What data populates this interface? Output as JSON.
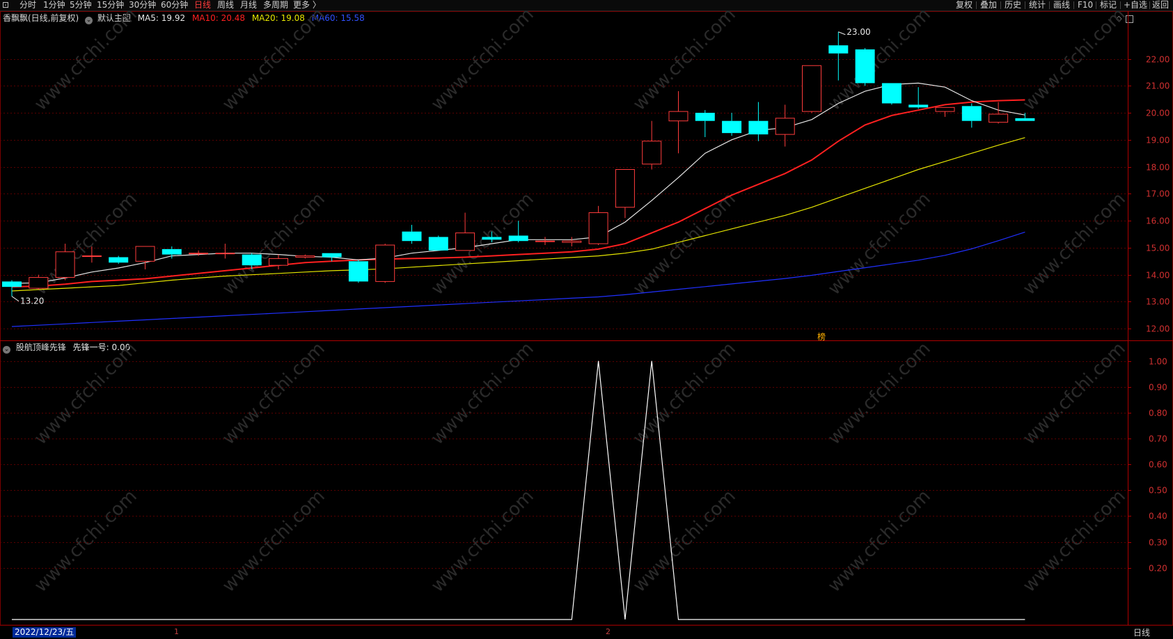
{
  "toolbar": {
    "left_icon": "⊡",
    "periods": [
      "分时",
      "1分钟",
      "5分钟",
      "15分钟",
      "30分钟",
      "60分钟",
      "日线",
      "周线",
      "月线",
      "多周期",
      "更多 〉"
    ],
    "active_period": "日线",
    "right_items": [
      "复权",
      "叠加",
      "历史",
      "统计",
      "画线",
      "F10",
      "标记",
      "+自选",
      "返回"
    ]
  },
  "main_header": {
    "stock_name": "香飘飘(日线,前复权)",
    "template": "默认主图",
    "ma5": "MA5: 19.92",
    "ma10": "MA10: 20.48",
    "ma20": "MA20: 19.08",
    "ma60": "MA60: 15.58"
  },
  "sub_header": {
    "indicator": "股航顶峰先锋",
    "line": "先锋一号: 0.00"
  },
  "price_annotations": {
    "high": "23.00",
    "low": "13.20",
    "marker": "榜"
  },
  "watermark": "www.cfchi.com",
  "colors": {
    "up": "#ff3c3c",
    "down": "#00ffff",
    "ma5": "#e6e6e6",
    "ma10": "#ff2020",
    "ma20": "#e6e600",
    "ma60": "#2030ff",
    "grid": "#5a0000"
  },
  "bottom": {
    "date": "2022/12/23/五",
    "month_1": "1",
    "month_2": "2",
    "period_label": "日线"
  },
  "chart_data": [
    {
      "type": "candlestick",
      "title": "香飘飘(日线,前复权)",
      "ylim": [
        11.8,
        23.2
      ],
      "y_ticks": [
        12.0,
        13.0,
        14.0,
        15.0,
        16.0,
        17.0,
        18.0,
        19.0,
        20.0,
        21.0,
        22.0
      ],
      "y_tick_labels": [
        "12.00",
        "13.00",
        "14.00",
        "15.00",
        "16.00",
        "17.00",
        "18.00",
        "19.00",
        "20.00",
        "21.00",
        "22.00"
      ],
      "candles": [
        {
          "o": 13.75,
          "h": 13.8,
          "c": 13.55,
          "l": 13.2
        },
        {
          "o": 13.5,
          "h": 14.0,
          "c": 13.9,
          "l": 13.45
        },
        {
          "o": 13.9,
          "h": 15.15,
          "c": 14.85,
          "l": 13.8
        },
        {
          "o": 14.7,
          "h": 15.05,
          "c": 14.7,
          "l": 14.45
        },
        {
          "o": 14.65,
          "h": 14.7,
          "c": 14.45,
          "l": 14.4
        },
        {
          "o": 14.5,
          "h": 15.05,
          "c": 15.05,
          "l": 14.2
        },
        {
          "o": 14.95,
          "h": 15.05,
          "c": 14.75,
          "l": 14.6
        },
        {
          "o": 14.8,
          "h": 14.9,
          "c": 14.8,
          "l": 14.7
        },
        {
          "o": 14.8,
          "h": 15.15,
          "c": 14.8,
          "l": 14.6
        },
        {
          "o": 14.75,
          "h": 14.8,
          "c": 14.35,
          "l": 14.2
        },
        {
          "o": 14.35,
          "h": 14.75,
          "c": 14.6,
          "l": 14.2
        },
        {
          "o": 14.65,
          "h": 14.75,
          "c": 14.7,
          "l": 14.6
        },
        {
          "o": 14.8,
          "h": 14.8,
          "c": 14.65,
          "l": 14.5
        },
        {
          "o": 14.5,
          "h": 14.55,
          "c": 13.75,
          "l": 13.7
        },
        {
          "o": 13.75,
          "h": 15.15,
          "c": 15.1,
          "l": 13.7
        },
        {
          "o": 15.6,
          "h": 15.85,
          "c": 15.25,
          "l": 15.15
        },
        {
          "o": 15.4,
          "h": 15.45,
          "c": 14.9,
          "l": 14.9
        },
        {
          "o": 14.9,
          "h": 16.3,
          "c": 15.55,
          "l": 14.9
        },
        {
          "o": 15.4,
          "h": 15.6,
          "c": 15.3,
          "l": 15.2
        },
        {
          "o": 15.45,
          "h": 16.0,
          "c": 15.25,
          "l": 15.2
        },
        {
          "o": 15.25,
          "h": 15.4,
          "c": 15.25,
          "l": 15.1
        },
        {
          "o": 15.2,
          "h": 15.4,
          "c": 15.25,
          "l": 15.05
        },
        {
          "o": 15.15,
          "h": 16.55,
          "c": 16.3,
          "l": 15.1
        },
        {
          "o": 16.5,
          "h": 17.9,
          "c": 17.9,
          "l": 16.1
        },
        {
          "o": 18.1,
          "h": 19.7,
          "c": 18.95,
          "l": 17.9
        },
        {
          "o": 19.7,
          "h": 20.8,
          "c": 20.05,
          "l": 18.5
        },
        {
          "o": 20.0,
          "h": 20.1,
          "c": 19.7,
          "l": 19.1
        },
        {
          "o": 19.7,
          "h": 20.0,
          "c": 19.25,
          "l": 19.15
        },
        {
          "o": 19.7,
          "h": 20.4,
          "c": 19.2,
          "l": 18.95
        },
        {
          "o": 19.2,
          "h": 20.3,
          "c": 19.8,
          "l": 18.75
        },
        {
          "o": 20.05,
          "h": 21.75,
          "c": 21.75,
          "l": 20.0
        },
        {
          "o": 22.5,
          "h": 23.0,
          "c": 22.2,
          "l": 21.2
        },
        {
          "o": 22.35,
          "h": 22.4,
          "c": 21.1,
          "l": 21.0
        },
        {
          "o": 21.1,
          "h": 21.1,
          "c": 20.35,
          "l": 20.3
        },
        {
          "o": 20.3,
          "h": 20.95,
          "c": 20.2,
          "l": 20.15
        },
        {
          "o": 20.05,
          "h": 20.2,
          "c": 20.2,
          "l": 19.85
        },
        {
          "o": 20.25,
          "h": 20.35,
          "c": 19.7,
          "l": 19.45
        },
        {
          "o": 19.65,
          "h": 20.4,
          "c": 19.95,
          "l": 19.6
        },
        {
          "o": 19.8,
          "h": 20.0,
          "c": 19.7,
          "l": 19.7
        }
      ],
      "ma5": [
        13.68,
        13.7,
        13.88,
        14.1,
        14.25,
        14.45,
        14.7,
        14.75,
        14.8,
        14.8,
        14.75,
        14.68,
        14.65,
        14.55,
        14.62,
        14.8,
        14.9,
        15.0,
        15.15,
        15.3,
        15.3,
        15.3,
        15.4,
        15.95,
        16.75,
        17.6,
        18.5,
        19.0,
        19.35,
        19.45,
        19.75,
        20.35,
        20.8,
        21.05,
        21.1,
        20.95,
        20.45,
        20.1,
        19.92
      ],
      "ma10": [
        13.55,
        13.58,
        13.65,
        13.75,
        13.8,
        13.85,
        13.95,
        14.05,
        14.15,
        14.25,
        14.35,
        14.45,
        14.5,
        14.55,
        14.58,
        14.6,
        14.62,
        14.65,
        14.7,
        14.75,
        14.8,
        14.85,
        14.95,
        15.15,
        15.55,
        15.95,
        16.45,
        16.95,
        17.35,
        17.75,
        18.25,
        18.95,
        19.55,
        19.9,
        20.1,
        20.3,
        20.4,
        20.45,
        20.48
      ],
      "ma20": [
        13.4,
        13.45,
        13.5,
        13.55,
        13.6,
        13.7,
        13.8,
        13.88,
        13.95,
        14.0,
        14.05,
        14.1,
        14.15,
        14.18,
        14.22,
        14.28,
        14.34,
        14.4,
        14.46,
        14.52,
        14.58,
        14.64,
        14.7,
        14.8,
        14.95,
        15.2,
        15.45,
        15.7,
        15.95,
        16.2,
        16.5,
        16.85,
        17.2,
        17.55,
        17.9,
        18.2,
        18.5,
        18.8,
        19.08
      ],
      "ma60": [
        12.08,
        12.13,
        12.18,
        12.23,
        12.28,
        12.33,
        12.38,
        12.43,
        12.48,
        12.53,
        12.58,
        12.63,
        12.68,
        12.73,
        12.78,
        12.83,
        12.88,
        12.93,
        12.98,
        13.03,
        13.08,
        13.13,
        13.18,
        13.26,
        13.36,
        13.46,
        13.56,
        13.66,
        13.76,
        13.86,
        13.98,
        14.12,
        14.26,
        14.4,
        14.54,
        14.72,
        14.96,
        15.26,
        15.58
      ]
    },
    {
      "type": "line",
      "title": "股航顶峰先锋",
      "series": [
        {
          "name": "先锋一号",
          "values": [
            0,
            0,
            0,
            0,
            0,
            0,
            0,
            0,
            0,
            0,
            0,
            0,
            0,
            0,
            0,
            0,
            0,
            0,
            0,
            0,
            0,
            0,
            1,
            0,
            1,
            0,
            0,
            0,
            0,
            0,
            0,
            0,
            0,
            0,
            0,
            0,
            0,
            0,
            0
          ]
        }
      ],
      "ylim": [
        0,
        1.05
      ],
      "y_ticks": [
        0.2,
        0.3,
        0.4,
        0.5,
        0.6,
        0.7,
        0.8,
        0.9,
        1.0
      ],
      "y_tick_labels": [
        "0.20",
        "0.30",
        "0.40",
        "0.50",
        "0.60",
        "0.70",
        "0.80",
        "0.90",
        "1.00"
      ]
    }
  ]
}
